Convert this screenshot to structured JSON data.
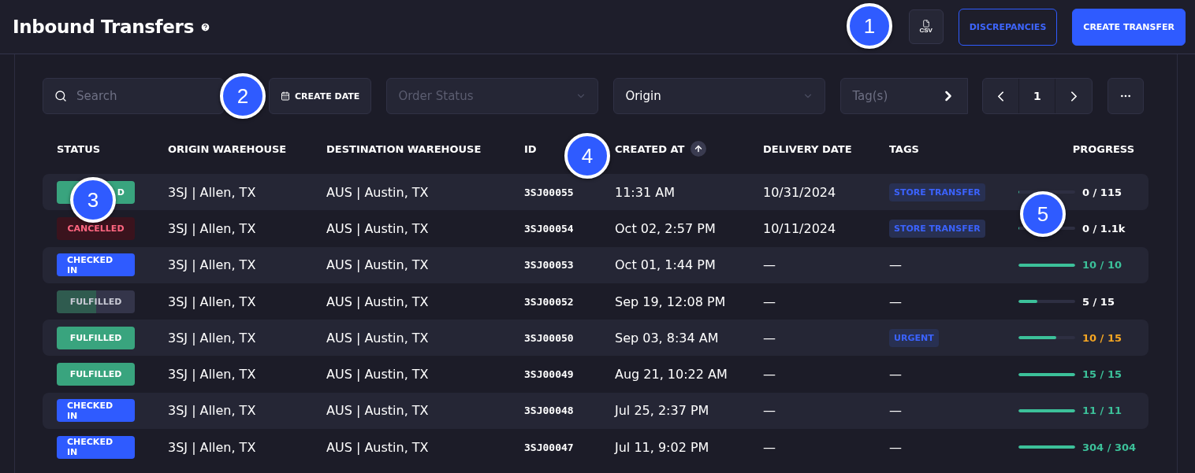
{
  "header": {
    "title": "Inbound Transfers",
    "csv_label": "CSV",
    "buttons": [
      {
        "label": "DISCREPANCIES",
        "kind": "outline"
      },
      {
        "label": "CREATE TRANSFER",
        "kind": "primary"
      }
    ]
  },
  "toolbar": {
    "search": {
      "placeholder": "Search"
    },
    "create_date": "CREATE DATE",
    "order_status": {
      "placeholder": "Order Status",
      "disabled": true
    },
    "origin": {
      "value": "Origin",
      "disabled": false
    },
    "tags": {
      "placeholder": "Tag(s)"
    },
    "page": "1"
  },
  "table": {
    "columns": [
      "STATUS",
      "ORIGIN WAREHOUSE",
      "DESTINATION WAREHOUSE",
      "ID",
      "CREATED AT",
      "DELIVERY DATE",
      "TAGS",
      "PROGRESS"
    ],
    "rows": [
      {
        "status": {
          "kind": "fulfilled",
          "label": "D",
          "covered": true
        },
        "origin": "3SJ | Allen, TX",
        "destination": "AUS | Austin, TX",
        "id": "3SJ00055",
        "created": "11:31 AM",
        "delivery": "10/31/2024",
        "tag": {
          "kind": "chip",
          "label": "STORE TRANSFER"
        },
        "progress": {
          "level": 0,
          "reading": "0 / 115",
          "kind": "plain"
        }
      },
      {
        "status": {
          "kind": "cancelled",
          "label": "CANCELLED"
        },
        "origin": "3SJ | Allen, TX",
        "destination": "AUS | Austin, TX",
        "id": "3SJ00054",
        "created": "Oct 02, 2:57 PM",
        "delivery": "10/11/2024",
        "tag": {
          "kind": "chip",
          "label": "STORE TRANSFER"
        },
        "progress": {
          "level": 0,
          "reading": "0 / 1.1k",
          "kind": "plain"
        }
      },
      {
        "status": {
          "kind": "checked_in",
          "label": "CHECKED IN"
        },
        "origin": "3SJ | Allen, TX",
        "destination": "AUS | Austin, TX",
        "id": "3SJ00053",
        "created": "Oct 01, 1:44 PM",
        "delivery": "—",
        "tag": {
          "kind": "empty",
          "label": "—"
        },
        "progress": {
          "level": 1,
          "reading": "10 / 10",
          "kind": "complete"
        }
      },
      {
        "status": {
          "kind": "partial",
          "label": "FULFILLED",
          "level": 0.5
        },
        "origin": "3SJ | Allen, TX",
        "destination": "AUS | Austin, TX",
        "id": "3SJ00052",
        "created": "Sep 19, 12:08 PM",
        "delivery": "—",
        "tag": {
          "kind": "empty",
          "label": "—"
        },
        "progress": {
          "level": 0.33,
          "reading": "5 / 15",
          "kind": "plain"
        }
      },
      {
        "status": {
          "kind": "fulfilled",
          "label": "FULFILLED"
        },
        "origin": "3SJ | Allen, TX",
        "destination": "AUS | Austin, TX",
        "id": "3SJ00050",
        "created": "Sep 03, 8:34 AM",
        "delivery": "—",
        "tag": {
          "kind": "chip",
          "label": "URGENT"
        },
        "progress": {
          "level": 0.67,
          "reading": "10 / 15",
          "kind": "warning"
        }
      },
      {
        "status": {
          "kind": "fulfilled",
          "label": "FULFILLED"
        },
        "origin": "3SJ | Allen, TX",
        "destination": "AUS | Austin, TX",
        "id": "3SJ00049",
        "created": "Aug 21, 10:22 AM",
        "delivery": "—",
        "tag": {
          "kind": "empty",
          "label": "—"
        },
        "progress": {
          "level": 1,
          "reading": "15 / 15",
          "kind": "complete"
        }
      },
      {
        "status": {
          "kind": "checked_in",
          "label": "CHECKED IN"
        },
        "origin": "3SJ | Allen, TX",
        "destination": "AUS | Austin, TX",
        "id": "3SJ00048",
        "created": "Jul 25, 2:37 PM",
        "delivery": "—",
        "tag": {
          "kind": "empty",
          "label": "—"
        },
        "progress": {
          "level": 1,
          "reading": "11 / 11",
          "kind": "complete"
        }
      },
      {
        "status": {
          "kind": "checked_in",
          "label": "CHECKED IN"
        },
        "origin": "3SJ | Allen, TX",
        "destination": "AUS | Austin, TX",
        "id": "3SJ00047",
        "created": "Jul 11, 9:02 PM",
        "delivery": "—",
        "tag": {
          "kind": "empty",
          "label": "—"
        },
        "progress": {
          "level": 1,
          "reading": "304 / 304",
          "kind": "complete"
        }
      }
    ]
  },
  "callouts": [
    {
      "number": "1"
    },
    {
      "number": "2"
    },
    {
      "number": "3"
    },
    {
      "number": "4"
    },
    {
      "number": "5"
    }
  ]
}
